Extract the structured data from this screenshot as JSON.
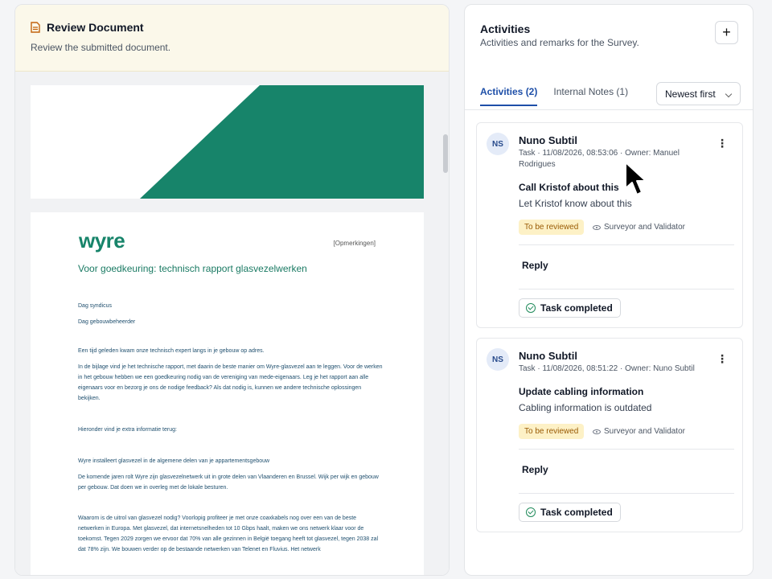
{
  "review": {
    "title": "Review Document",
    "subtitle": "Review the submitted document."
  },
  "document": {
    "logo_text": "wyre",
    "tag": "[Opmerkingen]",
    "heading": "Voor goedkeuring: technisch rapport glasvezelwerken",
    "salutation1": "Dag syndicus",
    "salutation2": "Dag gebouwbeheerder",
    "p1": "Een tijd geleden kwam onze technisch expert langs in je gebouw op adres.",
    "p2": "In de bijlage vind je het technische rapport, met daarin de beste manier om Wyre-glasvezel aan te leggen. Voor de werken in het gebouw hebben we een goedkeuring nodig van de vereniging van mede-eigenaars. Leg je het rapport aan alle eigenaars voor en bezorg je ons de nodige feedback? Als dat nodig is, kunnen we andere technische oplossingen bekijken.",
    "p3": "Hieronder vind je extra informatie terug:",
    "p4": "Wyre installeert glasvezel in de algemene delen van je appartementsgebouw",
    "p5": "De komende jaren rolt Wyre zijn glasvezelnetwerk uit in grote delen van Vlaanderen en Brussel. Wijk per wijk en gebouw per gebouw. Dat doen we in overleg met de lokale besturen.",
    "p6": "Waarom is de uitrol van glasvezel nodig? Voorlopig profiteer je met onze coaxkabels nog over een van de beste netwerken in Europa. Met glasvezel, dat internetsnelheden tot 10 Gbps haalt, maken we ons netwerk klaar voor de toekomst. Tegen 2029 zorgen we ervoor dat 70% van alle gezinnen in België toegang heeft tot glasvezel, tegen 2038 zal dat 78% zijn. We bouwen verder op de bestaande netwerken van Telenet en Fluvius. Het netwerk"
  },
  "activities": {
    "title": "Activities",
    "subtitle": "Activities and remarks for the Survey.",
    "add_label": "+",
    "tabs": [
      {
        "label": "Activities (2)"
      },
      {
        "label": "Internal Notes (1)"
      }
    ],
    "sort_value": "Newest first",
    "items": [
      {
        "initials": "NS",
        "author": "Nuno Subtil",
        "meta": "Task · 11/08/2026, 08:53:06 · Owner: Manuel Rodrigues",
        "more": "⋮",
        "task_title": "Call Kristof about this",
        "task_desc": "Let Kristof know about this",
        "status": "To be reviewed",
        "visibility": "Surveyor and Validator",
        "reply": "Reply",
        "done": "Task completed"
      },
      {
        "initials": "NS",
        "author": "Nuno Subtil",
        "meta": "Task · 11/08/2026, 08:51:22 · Owner: Nuno Subtil",
        "more": "⋮",
        "task_title": "Update cabling information",
        "task_desc": "Cabling information is outdated",
        "status": "To be reviewed",
        "visibility": "Surveyor and Validator",
        "reply": "Reply",
        "done": "Task completed"
      }
    ]
  },
  "icons": {
    "doc": "document-icon",
    "eye": "eye-icon",
    "check": "check-circle-icon",
    "chevron": "chevron-down-icon",
    "kebab": "more-vertical-icon",
    "cursor": "mouse-pointer-icon"
  },
  "colors": {
    "brand_green": "#17846a",
    "accent_blue": "#1e4fa8",
    "badge_bg": "#fdf1c6",
    "badge_text": "#9a5b05",
    "header_bg": "#fbf8ea"
  }
}
